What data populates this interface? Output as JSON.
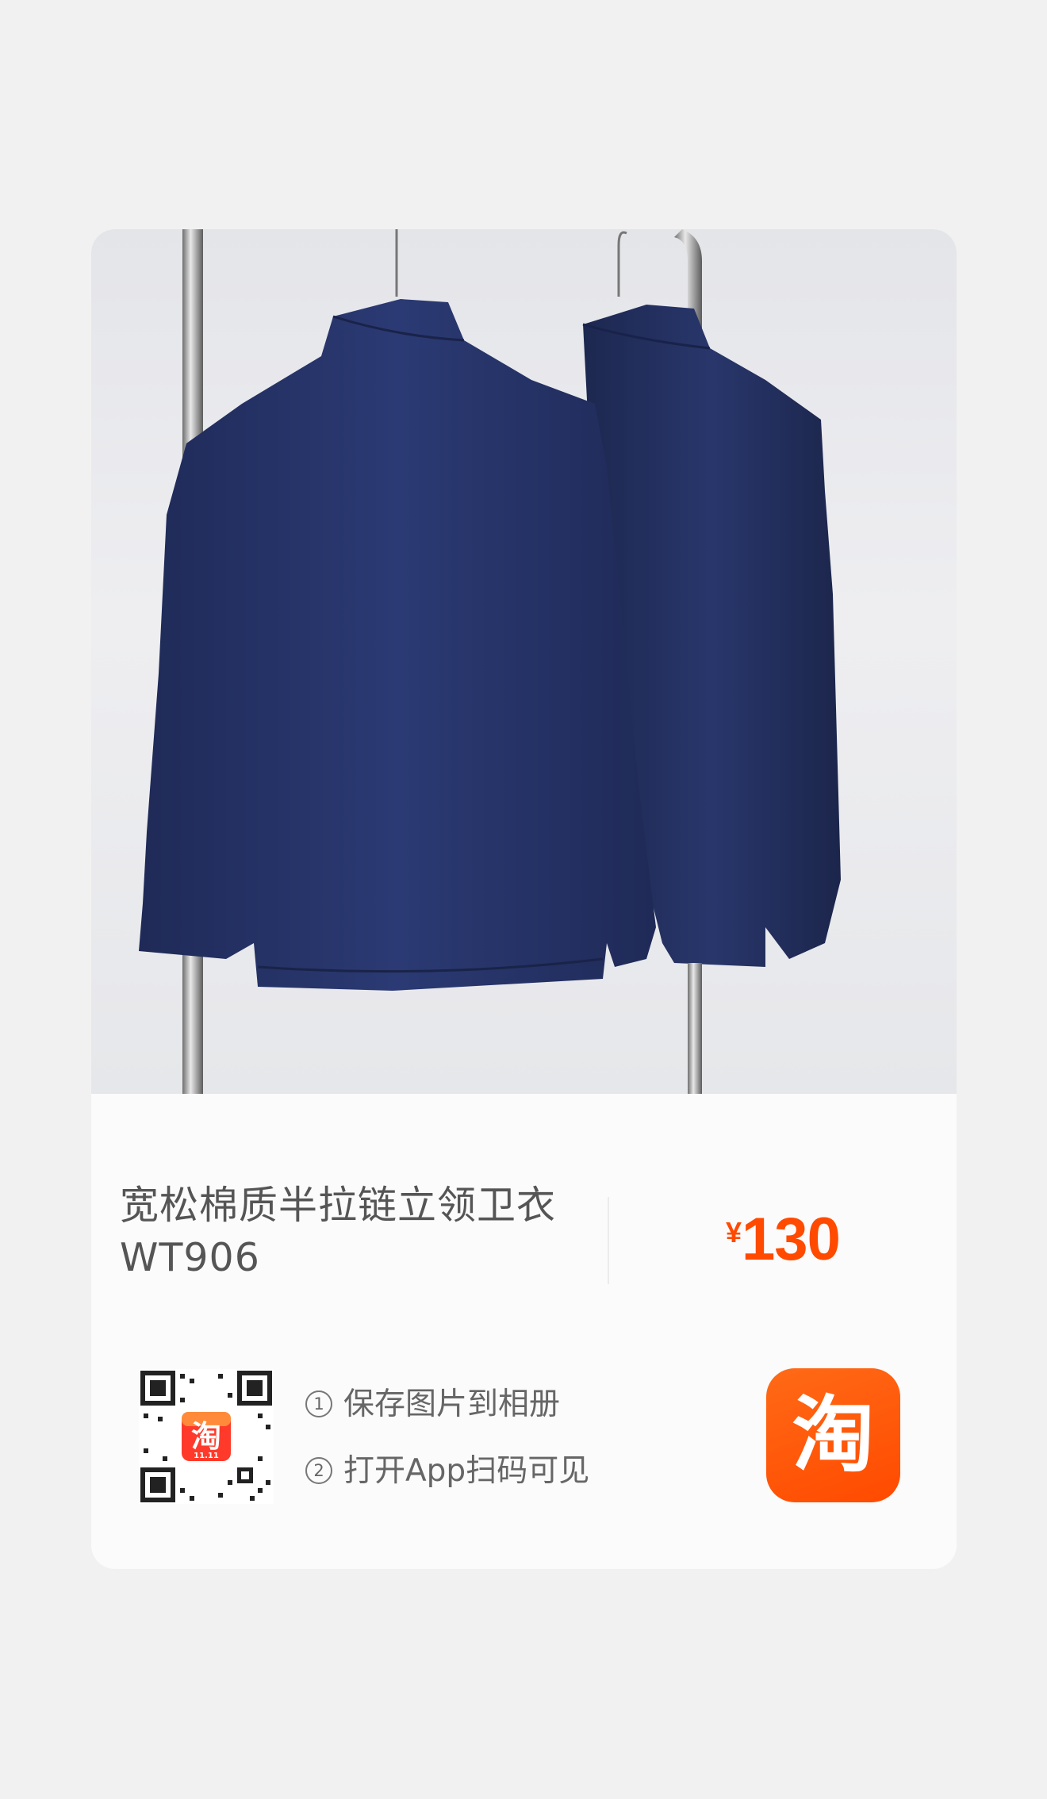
{
  "product": {
    "title": "宽松棉质半拉链立领卫衣WT906",
    "currency": "¥",
    "price": "130"
  },
  "steps": [
    {
      "num": "1",
      "text": "保存图片到相册"
    },
    {
      "num": "2",
      "text": "打开App扫码可见"
    }
  ],
  "qr_badge": {
    "glyph": "淘",
    "caption": "11.11"
  },
  "app_logo": {
    "glyph": "淘"
  },
  "icons": {
    "qr": "qr-code-icon",
    "logo": "taobao-logo-icon"
  },
  "colors": {
    "price": "#ff4a00",
    "logo_bg": "#ff5000",
    "garment": "#263366"
  }
}
